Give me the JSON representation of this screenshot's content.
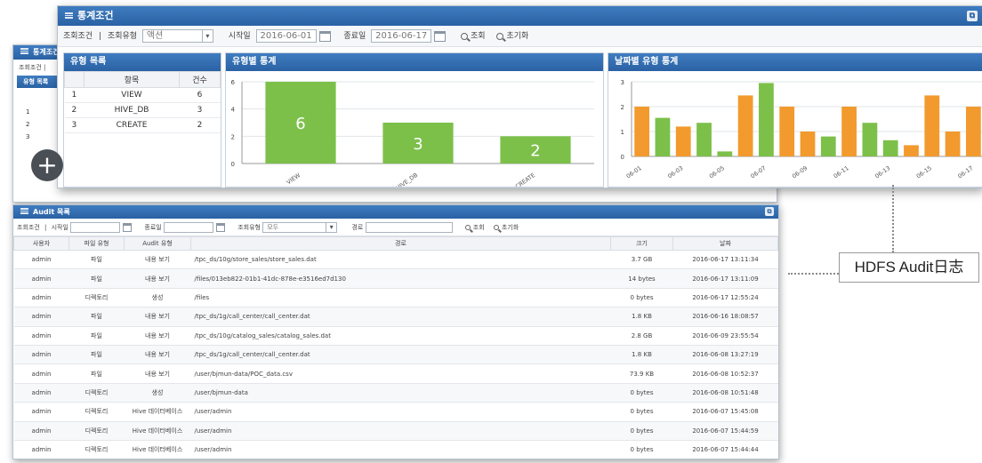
{
  "front": {
    "title": "통계조건",
    "filter": {
      "query_label": "조회조건",
      "sep": "|",
      "type_label": "조회유형",
      "type_value": "액션",
      "start_label": "시작일",
      "start_value": "2016-06-01",
      "end_label": "종료일",
      "end_value": "2016-06-17",
      "search_label": "조회",
      "reset_label": "초기화"
    },
    "type_list": {
      "title": "유형 목록",
      "col_item": "항목",
      "col_count": "건수",
      "rows": [
        {
          "no": "1",
          "item": "VIEW",
          "count": "6"
        },
        {
          "no": "2",
          "item": "HIVE_DB",
          "count": "3"
        },
        {
          "no": "3",
          "item": "CREATE",
          "count": "2"
        }
      ]
    },
    "type_chart": {
      "title": "유형별 통계"
    },
    "date_chart": {
      "title": "날짜별 유형 통계"
    }
  },
  "chart_data": [
    {
      "type": "bar",
      "title": "유형별 통계",
      "categories": [
        "VIEW",
        "HIVE_DB",
        "CREATE"
      ],
      "values": [
        6,
        3,
        2
      ],
      "data_labels": [
        "6",
        "3",
        "2"
      ],
      "ylim": [
        0,
        6
      ],
      "yticks": [
        0,
        2,
        4,
        6
      ],
      "color": "#7cc04a",
      "grid": true
    },
    {
      "type": "bar",
      "title": "날짜별 유형 통계",
      "categories": [
        "06-01",
        "06-02",
        "06-03",
        "06-04",
        "06-05",
        "06-06",
        "06-07",
        "06-08",
        "06-09",
        "06-10",
        "06-11",
        "06-12",
        "06-13",
        "06-14",
        "06-15",
        "06-16",
        "06-17"
      ],
      "tick_labels": [
        "06-01",
        "06-03",
        "06-05",
        "06-07",
        "06-09",
        "06-11",
        "06-13",
        "06-15",
        "06-17"
      ],
      "values": [
        2,
        1.55,
        1.2,
        1.35,
        0.2,
        2.45,
        2.95,
        2,
        1,
        0.8,
        2,
        1.35,
        0.65,
        0.45,
        2.45,
        1,
        2
      ],
      "colors": [
        "#f29a2e",
        "#7cc04a",
        "#f29a2e",
        "#7cc04a",
        "#7cc04a",
        "#f29a2e",
        "#7cc04a",
        "#f29a2e",
        "#f29a2e",
        "#7cc04a",
        "#f29a2e",
        "#7cc04a",
        "#7cc04a",
        "#f29a2e",
        "#f29a2e",
        "#f29a2e",
        "#f29a2e"
      ],
      "ylim": [
        0,
        3
      ],
      "yticks": [
        0,
        1,
        2,
        3
      ],
      "grid": true
    }
  ],
  "back": {
    "title": "통계조건",
    "filter_short": "조회조건 |",
    "type_list_title": "유형 목록",
    "rows": [
      "1",
      "2",
      "3"
    ]
  },
  "audit": {
    "title": "Audit 목록",
    "filter": {
      "query_label": "조회조건",
      "sep": "|",
      "start_label": "시작일",
      "end_label": "종료일",
      "type_label": "조회유형",
      "type_value": "모두",
      "path_label": "경로",
      "search_label": "조회",
      "reset_label": "초기화"
    },
    "columns": [
      "사용자",
      "파일 유형",
      "Audit 유형",
      "경로",
      "크기",
      "날짜"
    ],
    "rows": [
      [
        "admin",
        "파일",
        "내용 보기",
        "/tpc_ds/10g/store_sales/store_sales.dat",
        "3.7 GB",
        "2016-06-17 13:11:34"
      ],
      [
        "admin",
        "파일",
        "내용 보기",
        "/files/013eb822-01b1-41dc-878e-e3516ed7d130",
        "14 bytes",
        "2016-06-17 13:11:09"
      ],
      [
        "admin",
        "디렉토리",
        "생성",
        "/files",
        "0 bytes",
        "2016-06-17 12:55:24"
      ],
      [
        "admin",
        "파일",
        "내용 보기",
        "/tpc_ds/1g/call_center/call_center.dat",
        "1.8 KB",
        "2016-06-16 18:08:57"
      ],
      [
        "admin",
        "파일",
        "내용 보기",
        "/tpc_ds/10g/catalog_sales/catalog_sales.dat",
        "2.8 GB",
        "2016-06-09 23:55:54"
      ],
      [
        "admin",
        "파일",
        "내용 보기",
        "/tpc_ds/1g/call_center/call_center.dat",
        "1.8 KB",
        "2016-06-08 13:27:19"
      ],
      [
        "admin",
        "파일",
        "내용 보기",
        "/user/bjmun-data/POC_data.csv",
        "73.9 KB",
        "2016-06-08 10:52:37"
      ],
      [
        "admin",
        "디렉토리",
        "생성",
        "/user/bjmun-data",
        "0 bytes",
        "2016-06-08 10:51:48"
      ],
      [
        "admin",
        "디렉토리",
        "Hive 데이터베이스",
        "/user/admin",
        "0 bytes",
        "2016-06-07 15:45:08"
      ],
      [
        "admin",
        "디렉토리",
        "Hive 데이터베이스",
        "/user/admin",
        "0 bytes",
        "2016-06-07 15:44:59"
      ],
      [
        "admin",
        "디렉토리",
        "Hive 데이터베이스",
        "/user/admin",
        "0 bytes",
        "2016-06-07 15:44:44"
      ]
    ]
  },
  "callout": {
    "label": "HDFS Audit日志"
  },
  "icons": {
    "add": "plus-icon",
    "window": "list-icon",
    "maximize": "maximize-icon",
    "calendar": "calendar-icon",
    "search": "search-icon",
    "reset": "reset-icon"
  }
}
